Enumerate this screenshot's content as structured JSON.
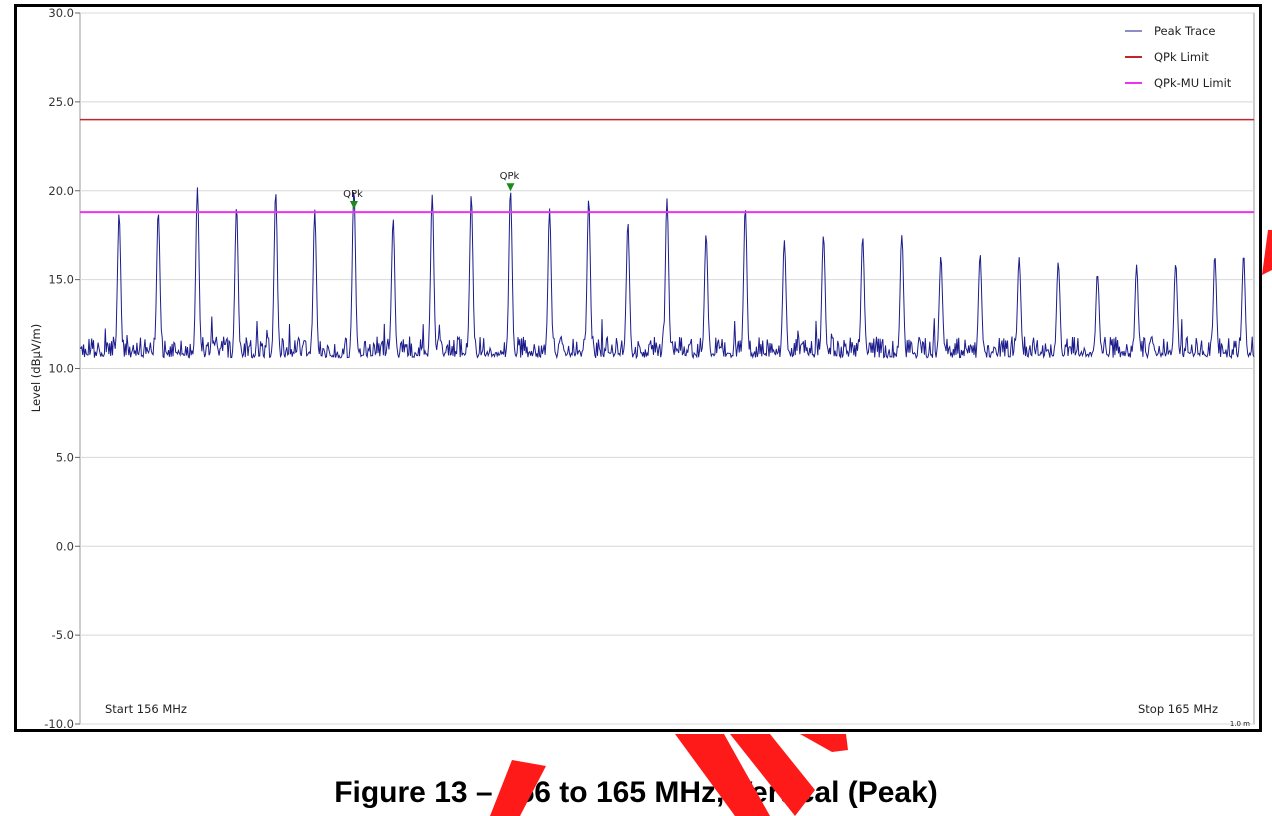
{
  "chart_data": {
    "type": "line",
    "ylabel": "Level (dBμV/m)",
    "ylim": [
      -10.0,
      30.0
    ],
    "yticks": [
      "30.0",
      "25.0",
      "20.0",
      "15.0",
      "10.0",
      "5.0",
      "0.0",
      "-5.0",
      "-10.0"
    ],
    "xlim": [
      156,
      165
    ],
    "x_unit": "MHz",
    "start_label": "Start 156 MHz",
    "stop_label": "Stop 165 MHz",
    "corner_label": "1.0 m",
    "grid": true,
    "legend_position": "top-right",
    "series": [
      {
        "name": "Peak Trace",
        "color": "#1c1c8c",
        "noise_floor": 10.9,
        "peaks": [
          {
            "x": 156.3,
            "y": 18.9
          },
          {
            "x": 156.6,
            "y": 19.0
          },
          {
            "x": 156.9,
            "y": 20.3
          },
          {
            "x": 157.2,
            "y": 19.2
          },
          {
            "x": 157.5,
            "y": 20.2
          },
          {
            "x": 157.8,
            "y": 19.0
          },
          {
            "x": 158.1,
            "y": 20.4
          },
          {
            "x": 158.4,
            "y": 18.6
          },
          {
            "x": 158.7,
            "y": 20.0
          },
          {
            "x": 159.0,
            "y": 19.9
          },
          {
            "x": 159.3,
            "y": 20.3
          },
          {
            "x": 159.6,
            "y": 19.1
          },
          {
            "x": 159.9,
            "y": 19.7
          },
          {
            "x": 160.2,
            "y": 18.3
          },
          {
            "x": 160.5,
            "y": 19.8
          },
          {
            "x": 160.8,
            "y": 17.7
          },
          {
            "x": 161.1,
            "y": 19.3
          },
          {
            "x": 161.4,
            "y": 17.5
          },
          {
            "x": 161.7,
            "y": 17.8
          },
          {
            "x": 162.0,
            "y": 17.6
          },
          {
            "x": 162.3,
            "y": 17.8
          },
          {
            "x": 162.6,
            "y": 16.5
          },
          {
            "x": 162.9,
            "y": 16.5
          },
          {
            "x": 163.2,
            "y": 16.4
          },
          {
            "x": 163.5,
            "y": 16.2
          },
          {
            "x": 163.8,
            "y": 15.5
          },
          {
            "x": 164.1,
            "y": 15.9
          },
          {
            "x": 164.4,
            "y": 16.1
          },
          {
            "x": 164.7,
            "y": 16.5
          },
          {
            "x": 164.92,
            "y": 16.5
          }
        ]
      },
      {
        "name": "QPk Limit",
        "color": "#c0262a",
        "value": 24.0
      },
      {
        "name": "QPk-MU Limit",
        "color": "#ee33ee",
        "value": 18.8
      }
    ],
    "markers": [
      {
        "label": "QPk",
        "x": 158.1,
        "y": 19.2
      },
      {
        "label": "QPk",
        "x": 159.3,
        "y": 20.2
      }
    ]
  },
  "caption": "Figure 13 – 156 to 165 MHz, Vertical (Peak)",
  "colors": {
    "marker": "#1a8a1a",
    "grid": "#d8d8d8",
    "watermark": "#ff1a1a"
  }
}
